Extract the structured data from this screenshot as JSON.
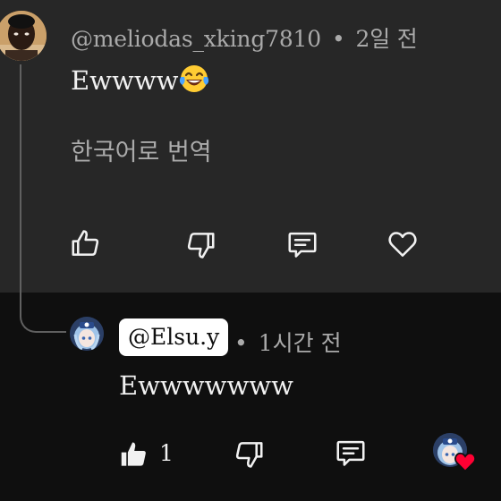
{
  "top_comment": {
    "username": "@meliodas_xking7810",
    "separator": "•",
    "time": "2일 전",
    "text": "Ewwww",
    "emoji": "face-with-tears-of-joy",
    "translate_label": "한국어로 번역",
    "actions": {
      "like_icon": "thumbs-up-outline-icon",
      "dislike_icon": "thumbs-down-outline-icon",
      "reply_icon": "comment-icon",
      "heart_icon": "heart-outline-icon"
    }
  },
  "reply": {
    "username": "@Elsu.y",
    "separator": "•",
    "time": "1시간 전",
    "text": "Ewwwwwww",
    "like_count": "1",
    "actions": {
      "like_icon": "thumbs-up-filled-icon",
      "dislike_icon": "thumbs-down-outline-icon",
      "reply_icon": "comment-icon",
      "creator_heart_icon": "creator-heart-icon"
    }
  },
  "colors": {
    "top_panel_bg": "#272727",
    "bottom_panel_bg": "#0f0f0f",
    "primary_text": "#f1f1f1",
    "secondary_text": "#aaaaaa",
    "heart_red": "#ff0033"
  }
}
